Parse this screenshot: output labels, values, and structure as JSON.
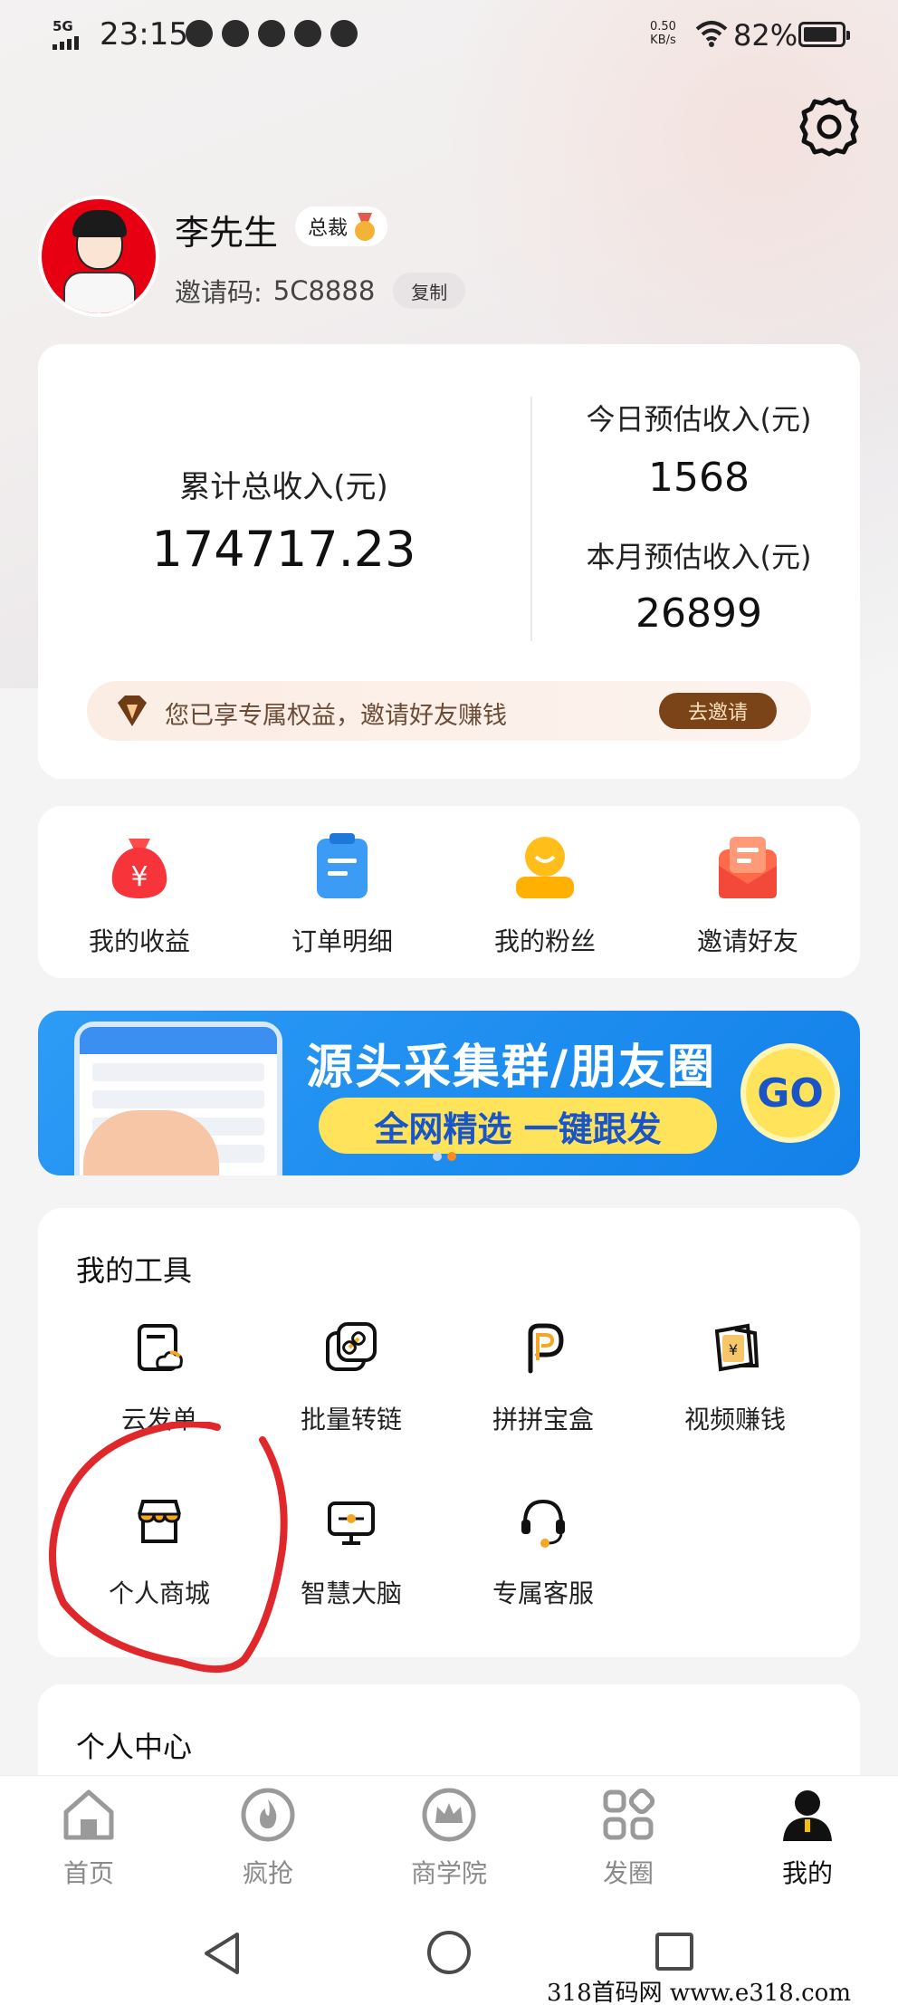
{
  "status_bar": {
    "network": "5G",
    "time": "23:15",
    "speed_value": "0.50",
    "speed_unit": "KB/s",
    "battery_percent": "82%",
    "battery_level": 0.82,
    "app_icons": [
      "cloud-icon",
      "wechat-icon",
      "check-circle-icon",
      "chat-bubble-icon",
      "message-icon"
    ]
  },
  "profile": {
    "name": "李先生",
    "rank": "总裁",
    "invite_label": "邀请码:",
    "invite_code": "5C8888",
    "copy_label": "复制"
  },
  "income": {
    "total_label": "累计总收入(元)",
    "total_value": "174717.23",
    "today_label": "今日预估收入(元)",
    "today_value": "1568",
    "month_label": "本月预估收入(元)",
    "month_value": "26899",
    "benefit_text": "您已享专属权益，邀请好友赚钱",
    "invite_button": "去邀请"
  },
  "shortcuts": [
    {
      "label": "我的收益",
      "icon": "money-bag-icon"
    },
    {
      "label": "订单明细",
      "icon": "clipboard-icon"
    },
    {
      "label": "我的粉丝",
      "icon": "fans-icon"
    },
    {
      "label": "邀请好友",
      "icon": "envelope-icon"
    }
  ],
  "banner": {
    "title": "源头采集群/朋友圈",
    "subtitle": "全网精选  一键跟发",
    "go": "GO"
  },
  "tools": {
    "title": "我的工具",
    "items": [
      {
        "label": "云发单",
        "icon": "cloud-doc-icon"
      },
      {
        "label": "批量转链",
        "icon": "link-icon"
      },
      {
        "label": "拼拼宝盒",
        "icon": "pinduoduo-icon"
      },
      {
        "label": "视频赚钱",
        "icon": "video-money-icon"
      },
      {
        "label": "个人商城",
        "icon": "store-icon"
      },
      {
        "label": "智慧大脑",
        "icon": "monitor-icon"
      },
      {
        "label": "专属客服",
        "icon": "headset-icon"
      }
    ]
  },
  "personal_center": {
    "title": "个人中心"
  },
  "tabbar": [
    {
      "label": "首页",
      "icon": "home-icon",
      "active": false
    },
    {
      "label": "疯抢",
      "icon": "flame-icon",
      "active": false
    },
    {
      "label": "商学院",
      "icon": "crown-icon",
      "active": false
    },
    {
      "label": "发圈",
      "icon": "grid-icon",
      "active": false
    },
    {
      "label": "我的",
      "icon": "user-icon",
      "active": true
    }
  ],
  "watermark": "318首码网  www.e318.com",
  "colors": {
    "accent_brown": "#7a4418",
    "annotation_red": "#e0282c",
    "banner_blue": "#1f8ef0",
    "banner_yellow": "#ffe35a"
  }
}
